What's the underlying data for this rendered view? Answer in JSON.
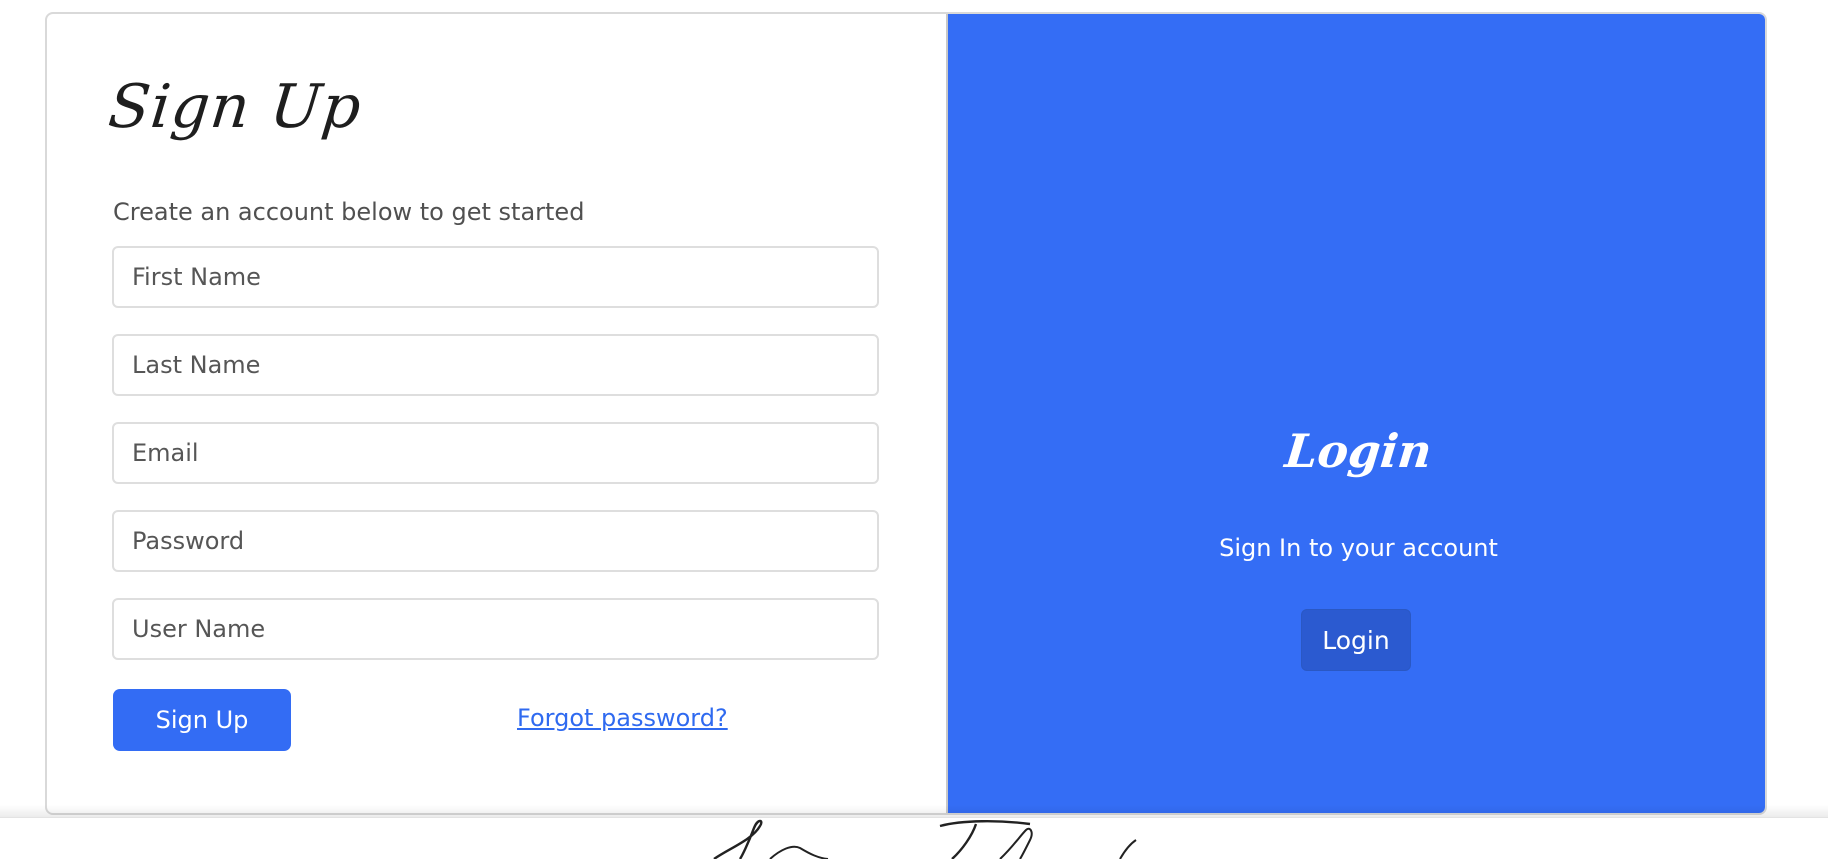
{
  "signup": {
    "title": "Sign Up",
    "subtitle": "Create an account below to get started",
    "fields": {
      "first_name_placeholder": "First Name",
      "last_name_placeholder": "Last Name",
      "email_placeholder": "Email",
      "password_placeholder": "Password",
      "username_placeholder": "User Name"
    },
    "submit_label": "Sign Up",
    "forgot_label": "Forgot password?"
  },
  "login": {
    "title": "Login",
    "subtitle": "Sign In to your account",
    "button_label": "Login"
  },
  "colors": {
    "primary": "#336cf4",
    "login_panel": "#346df5",
    "login_button": "#2b5ad0",
    "link": "#2f6af0",
    "heading": "#1e1e1e"
  }
}
